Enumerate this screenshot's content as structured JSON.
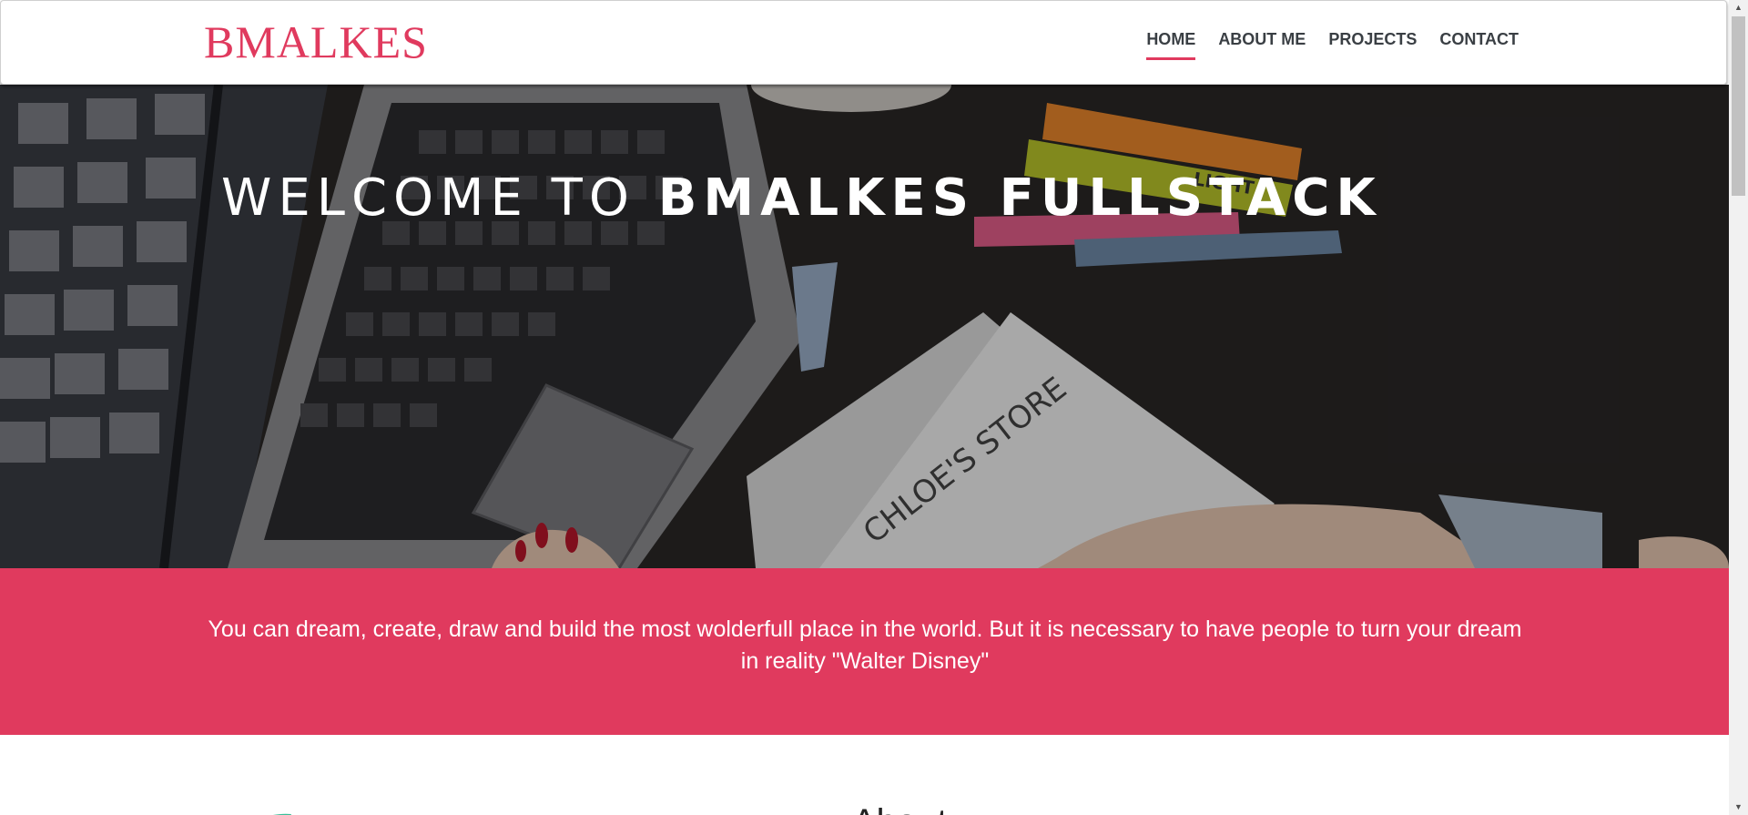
{
  "header": {
    "logo": "BMALKES",
    "nav": [
      {
        "label": "HOME",
        "active": true
      },
      {
        "label": "ABOUT ME",
        "active": false
      },
      {
        "label": "PROJECTS",
        "active": false
      },
      {
        "label": "CONTACT",
        "active": false
      }
    ]
  },
  "hero": {
    "title_light": "WELCOME TO ",
    "title_bold": "BMALKES FULLSTACK",
    "image_texts": {
      "marker": "LIGHT",
      "paper": "CHLOE'S STORE"
    }
  },
  "quote": {
    "text": "You can dream, create, draw and build the most wolderfull place in the world. But it is necessary to have people to turn your dream in reality \"Walter Disney\""
  },
  "about": {
    "heading": "About"
  },
  "colors": {
    "accent": "#e03a5e",
    "nav_text": "#3a3f44"
  }
}
